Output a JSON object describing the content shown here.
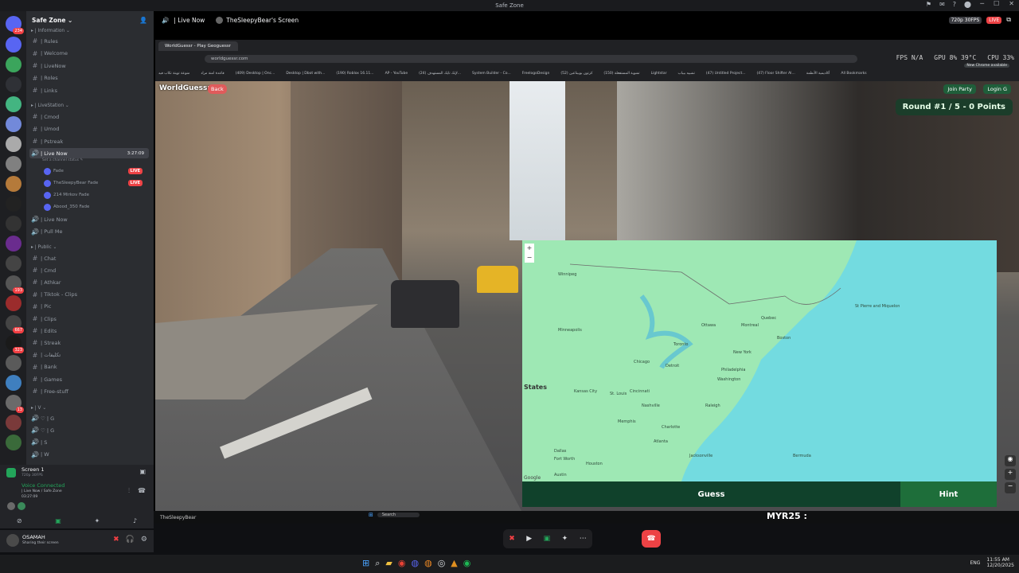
{
  "window": {
    "title": "Safe Zone",
    "controls": [
      "─",
      "☐",
      "✕"
    ],
    "toolbar_icons": [
      "⚑",
      "✉",
      "?",
      "⬤"
    ]
  },
  "rail": {
    "top_badge": "234",
    "servers": [
      {
        "color": "#5865f2",
        "badge": ""
      },
      {
        "color": "#3ba55c",
        "badge": ""
      },
      {
        "color": "#2f3136",
        "badge": ""
      },
      {
        "color": "#43b581",
        "badge": ""
      },
      {
        "color": "#7289da",
        "badge": ""
      },
      {
        "color": "#aaaaaa",
        "badge": ""
      },
      {
        "color": "#808080",
        "badge": ""
      },
      {
        "color": "#b57a3a",
        "badge": ""
      },
      {
        "color": "#222",
        "badge": ""
      },
      {
        "color": "#333",
        "badge": ""
      },
      {
        "color": "#6a2c8e",
        "badge": ""
      },
      {
        "color": "#444",
        "badge": ""
      },
      {
        "color": "#555",
        "badge": "193"
      },
      {
        "color": "#9b2c2c",
        "badge": ""
      },
      {
        "color": "#444",
        "badge": "667"
      },
      {
        "color": "#1a1a1a",
        "badge": "323"
      },
      {
        "color": "#5a5a5a",
        "badge": ""
      },
      {
        "color": "#3f7fbf",
        "badge": ""
      },
      {
        "color": "#6a6a6a",
        "badge": "13"
      },
      {
        "color": "#7a3a3a",
        "badge": ""
      },
      {
        "color": "#3a6a3a",
        "badge": ""
      }
    ]
  },
  "sidebar": {
    "server_name": "Safe Zone ⌄",
    "categories": {
      "information": "▸ | Information ⌄",
      "livestation": "▸ | LiveStation ⌄",
      "public": "▸ | Public ⌄",
      "v": "▸ | V ⌄"
    },
    "info_channels": [
      "| Rules",
      "| Welcome",
      "| LiveNow",
      "| Roles",
      "| Links"
    ],
    "live_channels": [
      "| Cmod",
      "| Umod",
      "| Pstreak"
    ],
    "active_channel": {
      "name": "| Live Now",
      "timer": "3:27:09",
      "status": "Set a channel status ✎"
    },
    "voice_members": [
      {
        "name": "Fade",
        "live": "LIVE"
      },
      {
        "name": "TheSleepyBear  Fade",
        "live": "LIVE"
      },
      {
        "name": "214 Mirkov  Fade",
        "live": ""
      },
      {
        "name": "Abood_350  Fade",
        "live": ""
      }
    ],
    "other_voice": [
      "| Live Now",
      "| Pull Me"
    ],
    "public_channels": [
      "| Chat",
      "| Cmd",
      "| Athkar",
      "| Tiktok - Clips",
      "| Pic",
      "| Clips",
      "| Edits",
      "| Streak",
      "| تكليفات",
      "| Bank",
      "| Games",
      "| Free-stuff"
    ],
    "v_channels": [
      "♡ | G",
      "♡ | G",
      "| S",
      "| W"
    ]
  },
  "screenpanel": {
    "title": "Screen 1",
    "sub": "720p 30FPS"
  },
  "voice_connected": {
    "title": "Voice Connected",
    "channel": "| Live Now / Safe Zone",
    "timer": "03:27:09"
  },
  "user": {
    "name": "OSAMAH",
    "status": "Sharing their screen"
  },
  "stream_header": {
    "channel": "| Live Now",
    "viewer": "TheSleepyBear's Screen",
    "quality": "720p 30FPS",
    "live": "LIVE"
  },
  "browser": {
    "tab": "WorldGuessr - Play Geoguessr",
    "url": "worldguessr.com",
    "bookmarks": [
      "منوعة تويتة تكاب فيد",
      "قاعدة امنة مراد",
      "(409) Desktop | Onc...",
      "Desktop | Dbot with...",
      "(190) Roblox 16.11...",
      "AP - YouTube",
      "(24) لإيك تايك المستهدف...",
      "System Builder - Co...",
      "FreelogoDesign",
      "(52) كرتون بوبيتاعين",
      "(150) تشوية المستفعلة",
      "Lightstar",
      "تشبيه بيباب",
      "(47) Untitled Project...",
      "(47) Floor Shifter AI...",
      "أكاديمية الأنظمة",
      "All Bookmarks"
    ],
    "metrics": {
      "fps": "FPS  N/A",
      "gpu": "GPU  8%  39°C",
      "cpu": "CPU  33%"
    },
    "new_chrome": "New Chrome available"
  },
  "game": {
    "logo": "WorldGuessr",
    "back": "Back",
    "join": "Join Party",
    "login": "Login G",
    "round": "Round #1 / 5 - 0 Points",
    "guess": "Guess",
    "hint": "Hint",
    "map_attrib": "Google",
    "map_labels": [
      "Winnipeg",
      "Ottawa",
      "Montreal",
      "Toronto",
      "Minneapolis",
      "Chicago",
      "New York",
      "Kansas City",
      "St. Louis",
      "Cincinnati",
      "Washington",
      "Charlotte",
      "Atlanta",
      "Fort Worth",
      "Dallas",
      "Austin",
      "Houston",
      "Bermuda",
      "St Pierre and Miquelon",
      "States",
      "Philadelphia",
      "Boston",
      "Detroit",
      "Memphis",
      "Nashville",
      "Raleigh",
      "Jacksonville",
      "Quebec"
    ]
  },
  "stream_footer": {
    "name": "TheSleepyBear",
    "search": "Search",
    "myr": "MYR25 :"
  },
  "taskbar": {
    "lang": "ENG",
    "time": "11:55 AM",
    "date": "12/20/2025"
  }
}
